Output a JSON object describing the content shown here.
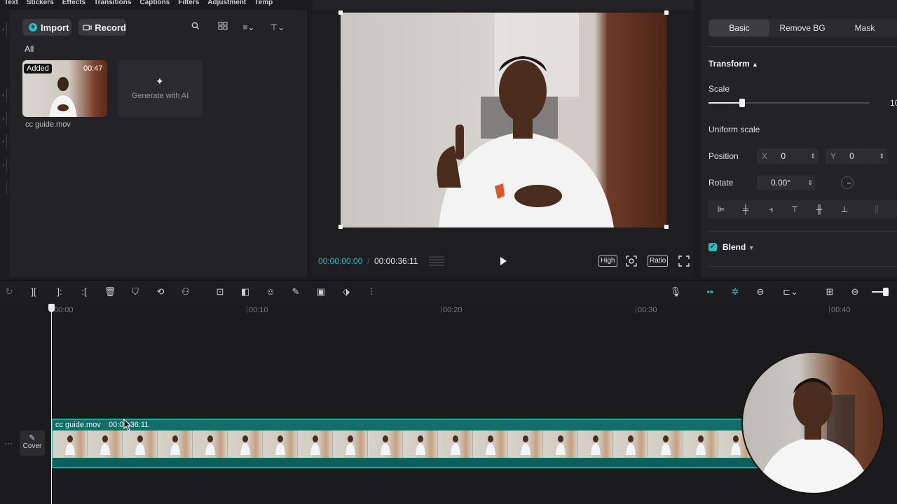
{
  "top_menu": [
    "Text",
    "Stickers",
    "Effects",
    "Transitions",
    "Captions",
    "Filters",
    "Adjustment",
    "Temp"
  ],
  "media": {
    "import_label": "Import",
    "record_label": "Record",
    "filter_label": "All",
    "clip": {
      "badge": "Added",
      "duration": "00:47",
      "name": "cc guide.mov"
    },
    "ai_label": "Generate with AI"
  },
  "preview": {
    "current_time": "00:00:00:00",
    "separator": "/",
    "total_time": "00:00:36:11",
    "quality_label": "High",
    "ratio_label": "Ratio"
  },
  "properties": {
    "tabs": [
      "Basic",
      "Remove BG",
      "Mask"
    ],
    "transform_label": "Transform",
    "scale_label": "Scale",
    "scale_value": "10",
    "scale_fraction": 0.2,
    "uniform_label": "Uniform scale",
    "position_label": "Position",
    "x_label": "X",
    "x_value": "0",
    "y_label": "Y",
    "y_value": "0",
    "rotate_label": "Rotate",
    "rotate_value": "0.00°",
    "blend_label": "Blend"
  },
  "timeline": {
    "ticks": [
      "00:00",
      "00:10",
      "00:20",
      "00:30",
      "00:40"
    ],
    "cover_label": "Cover",
    "track_name": "cc guide.mov",
    "track_duration": "00:00:36:11"
  },
  "colors": {
    "accent": "#20c2c5",
    "track": "#0f6f6a"
  }
}
